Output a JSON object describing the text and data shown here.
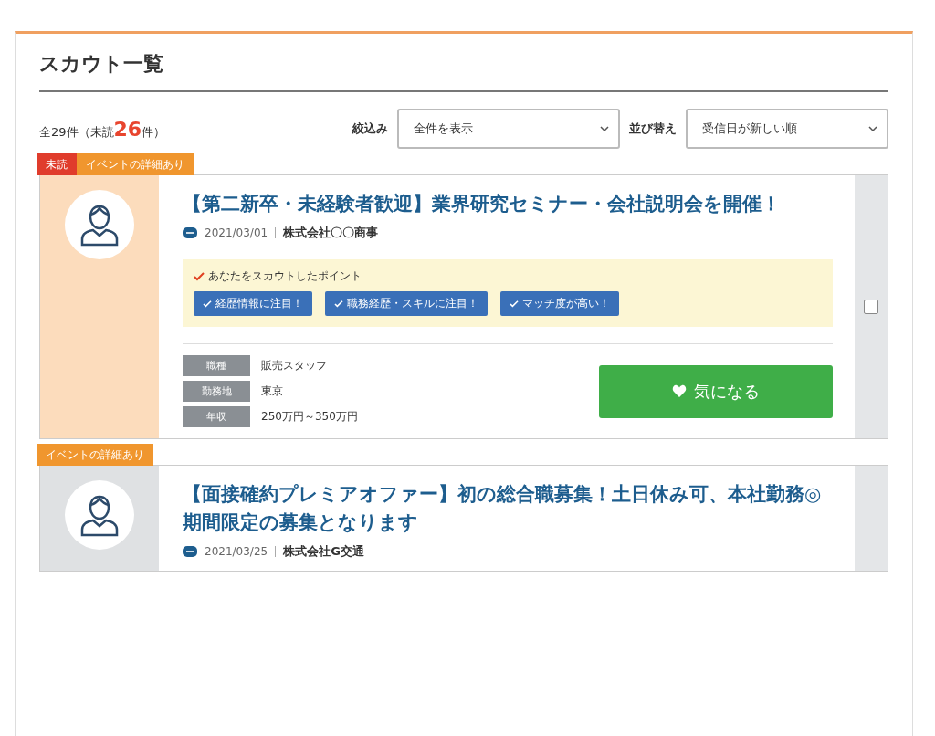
{
  "page": {
    "title": "スカウト一覧"
  },
  "summary": {
    "total": "全29件",
    "unread_prefix": "（未読",
    "unread_count": "26",
    "unread_suffix": "件）"
  },
  "filter": {
    "label": "絞込み",
    "value": "全件を表示"
  },
  "sort": {
    "label": "並び替え",
    "value": "受信日が新しい順"
  },
  "cards": [
    {
      "unread": true,
      "checked": false,
      "tags": [
        {
          "kind": "unread",
          "label": "未読"
        },
        {
          "kind": "event",
          "label": "イベントの詳細あり"
        }
      ],
      "title": "【第二新卒・未経験者歓迎】業界研究セミナー・会社説明会を開催！",
      "date": "2021/03/01",
      "company": "株式会社〇〇商事",
      "points": {
        "heading": "あなたをスカウトしたポイント",
        "chips": [
          "経歴情報に注目！",
          "職務経歴・スキルに注目！",
          "マッチ度が高い！"
        ]
      },
      "details": [
        {
          "label": "職種",
          "value": "販売スタッフ"
        },
        {
          "label": "勤務地",
          "value": "東京"
        },
        {
          "label": "年収",
          "value": "250万円～350万円"
        }
      ],
      "action": "気になる"
    },
    {
      "unread": false,
      "tags": [
        {
          "kind": "event",
          "label": "イベントの詳細あり"
        }
      ],
      "title": "【面接確約プレミアオファー】初の総合職募集！土日休み可、本社勤務◎　期間限定の募集となります",
      "date": "2021/03/25",
      "company": "株式会社G交通"
    }
  ]
}
